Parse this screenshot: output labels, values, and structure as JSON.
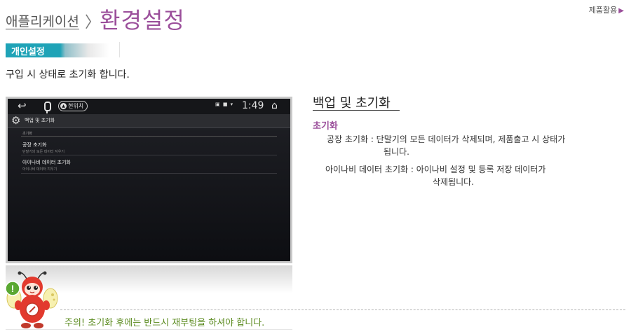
{
  "header": {
    "breadcrumb_parent": "애플리케이션",
    "separator": "〉",
    "title": "환경설정",
    "top_link": "제품활용",
    "top_link_arrow": "▶"
  },
  "section": {
    "tag": "개인설정",
    "intro": "구입 시 상태로 초기화 합니다."
  },
  "device": {
    "statusbar": {
      "back_icon": "↩",
      "position_label": "현위치",
      "position_icon": "▲",
      "status_icons": "▣ ■ ▾",
      "time": "1:49",
      "home_icon": "⌂"
    },
    "app_title": "백업 및 초기화",
    "category": "초기화",
    "options": [
      {
        "title": "공장 초기화",
        "subtitle": "단말기의 모든 데이터 지우기"
      },
      {
        "title": "아이나비 데이터 초기화",
        "subtitle": "아이나비 데이터 지우기"
      }
    ]
  },
  "description": {
    "title": "백업 및 초기화",
    "subheading": "초기화",
    "items": [
      {
        "line1": "공장 초기화 : 단말기의 모든 데이터가 삭제되며, 제품출고 시 상태가",
        "line2": "됩니다."
      },
      {
        "line1": "아이나비 데이터 초기화 : 아이나비 설정 및 등록 저장 데이터가",
        "line2": "삭제됩니다."
      }
    ]
  },
  "warning": {
    "text": "주의! 초기화 후에는 반드시 재부팅을 하셔야 합니다.",
    "mascot_badge": "!"
  },
  "colors": {
    "accent_purple": "#9b4f9b",
    "tag_teal": "#1fa3b7",
    "warning_green": "#5a8a1e",
    "mascot_red": "#e23a2e"
  }
}
